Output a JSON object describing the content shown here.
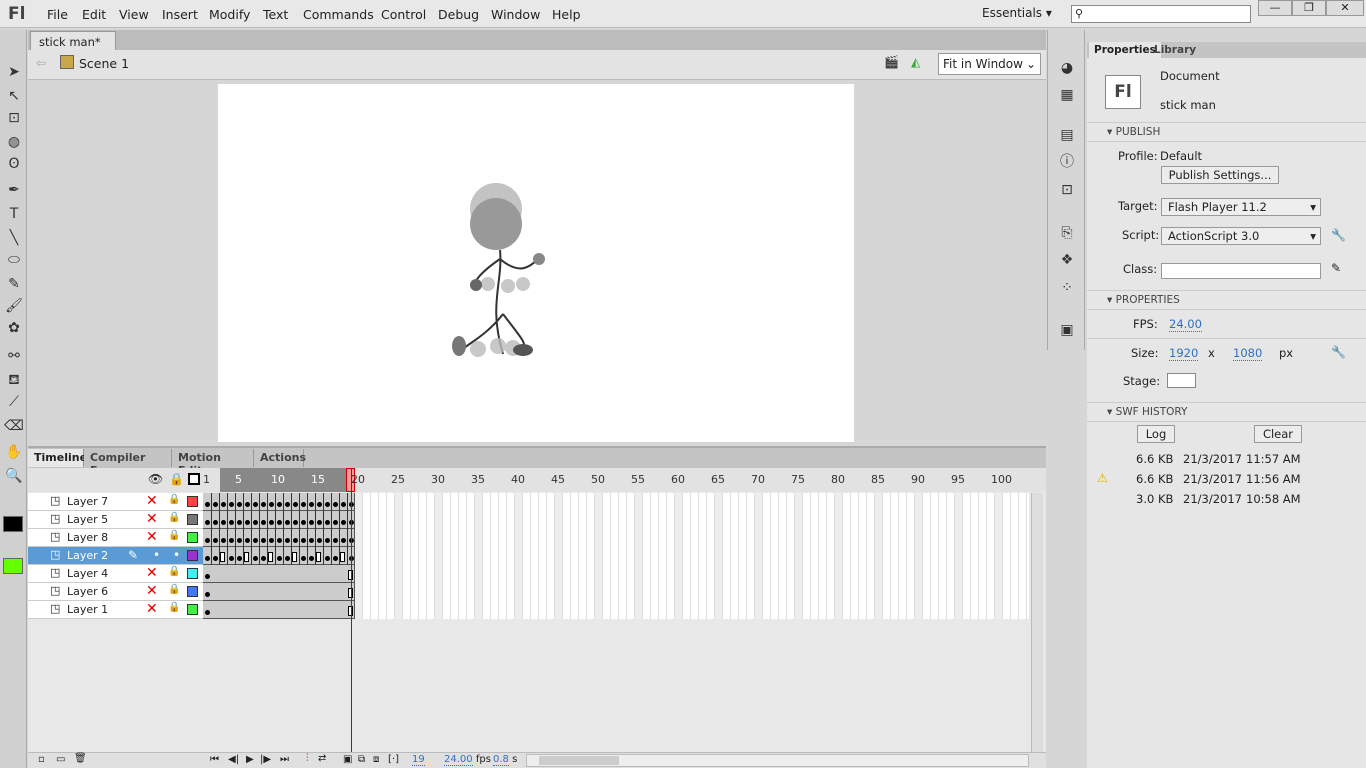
{
  "app": {
    "logo": "Fl",
    "menus": [
      "File",
      "Edit",
      "View",
      "Insert",
      "Modify",
      "Text",
      "Commands",
      "Control",
      "Debug",
      "Window",
      "Help"
    ],
    "workspace": "Essentials",
    "window_buttons": [
      "—",
      "❐",
      "✕"
    ]
  },
  "document": {
    "tab": "stick man*",
    "scene": "Scene 1",
    "zoom": "Fit in Window"
  },
  "tools": [
    "arrow-icon",
    "subselect-icon",
    "free-transform-icon",
    "3d-rotation-icon",
    "lasso-icon",
    "pen-icon",
    "text-icon",
    "line-icon",
    "oval-icon",
    "pencil-icon",
    "brush-icon",
    "deco-icon",
    "bone-icon",
    "paint-bucket-icon",
    "eyedropper-icon",
    "eraser-icon",
    "hand-icon",
    "zoom-icon"
  ],
  "colors": {
    "stroke": "#000000",
    "fill": "#66ff00",
    "accent": "#5b9bd5",
    "playhead": "#cc0000"
  },
  "timeline": {
    "tabs": [
      "Timeline",
      "Compiler Errors",
      "Motion Editor",
      "Actions"
    ],
    "ruler": [
      "1",
      "5",
      "10",
      "15",
      "20",
      "25",
      "30",
      "35",
      "40",
      "45",
      "50",
      "55",
      "60",
      "65",
      "70",
      "75",
      "80",
      "85",
      "90",
      "95",
      "100"
    ],
    "layers": [
      {
        "name": "Layer 7",
        "color": "#ff4444",
        "pattern": "kkkkkkkkkkkkkkkkkkk",
        "selected": false
      },
      {
        "name": "Layer 5",
        "color": "#777777",
        "pattern": "kkkkkkkkkkkkkkkkkkk",
        "selected": false
      },
      {
        "name": "Layer 8",
        "color": "#44ee44",
        "pattern": "kkkkkkkkkkkkkkkkkkk",
        "selected": false
      },
      {
        "name": "Layer 2",
        "color": "#9933cc",
        "pattern": "kkbkkbkkbkkbkkbkkbk",
        "selected": true
      },
      {
        "name": "Layer 4",
        "color": "#44eeee",
        "pattern": "k-----------------e",
        "selected": false
      },
      {
        "name": "Layer 6",
        "color": "#4477ee",
        "pattern": "k-----------------e",
        "selected": false
      },
      {
        "name": "Layer 1",
        "color": "#44ee44",
        "pattern": "k-----------------e",
        "selected": false
      }
    ],
    "current_frame": "19",
    "fps": "24.00",
    "fps_unit": "fps",
    "time": "0.8",
    "time_unit": "s"
  },
  "properties": {
    "tabs": [
      "Properties",
      "Library"
    ],
    "doc_label": "Document",
    "doc_name": "stick man",
    "doc_icon": "Fl",
    "publish": {
      "header": "PUBLISH",
      "profile_label": "Profile:",
      "profile": "Default",
      "settings_button": "Publish Settings...",
      "target_label": "Target:",
      "target": "Flash Player 11.2",
      "script_label": "Script:",
      "script": "ActionScript 3.0",
      "class_label": "Class:",
      "class_value": ""
    },
    "props": {
      "header": "PROPERTIES",
      "fps_label": "FPS:",
      "fps": "24.00",
      "size_label": "Size:",
      "width": "1920",
      "x": "x",
      "height": "1080",
      "unit": "px",
      "stage_label": "Stage:",
      "stage_color": "#ffffff"
    },
    "history": {
      "header": "SWF HISTORY",
      "log_button": "Log",
      "clear_button": "Clear",
      "entries": [
        {
          "size": "6.6 KB",
          "date": "21/3/2017",
          "time": "11:57 AM",
          "warning": false
        },
        {
          "size": "6.6 KB",
          "date": "21/3/2017",
          "time": "11:56 AM",
          "warning": true
        },
        {
          "size": "3.0 KB",
          "date": "21/3/2017",
          "time": "10:58 AM",
          "warning": false
        }
      ]
    }
  }
}
